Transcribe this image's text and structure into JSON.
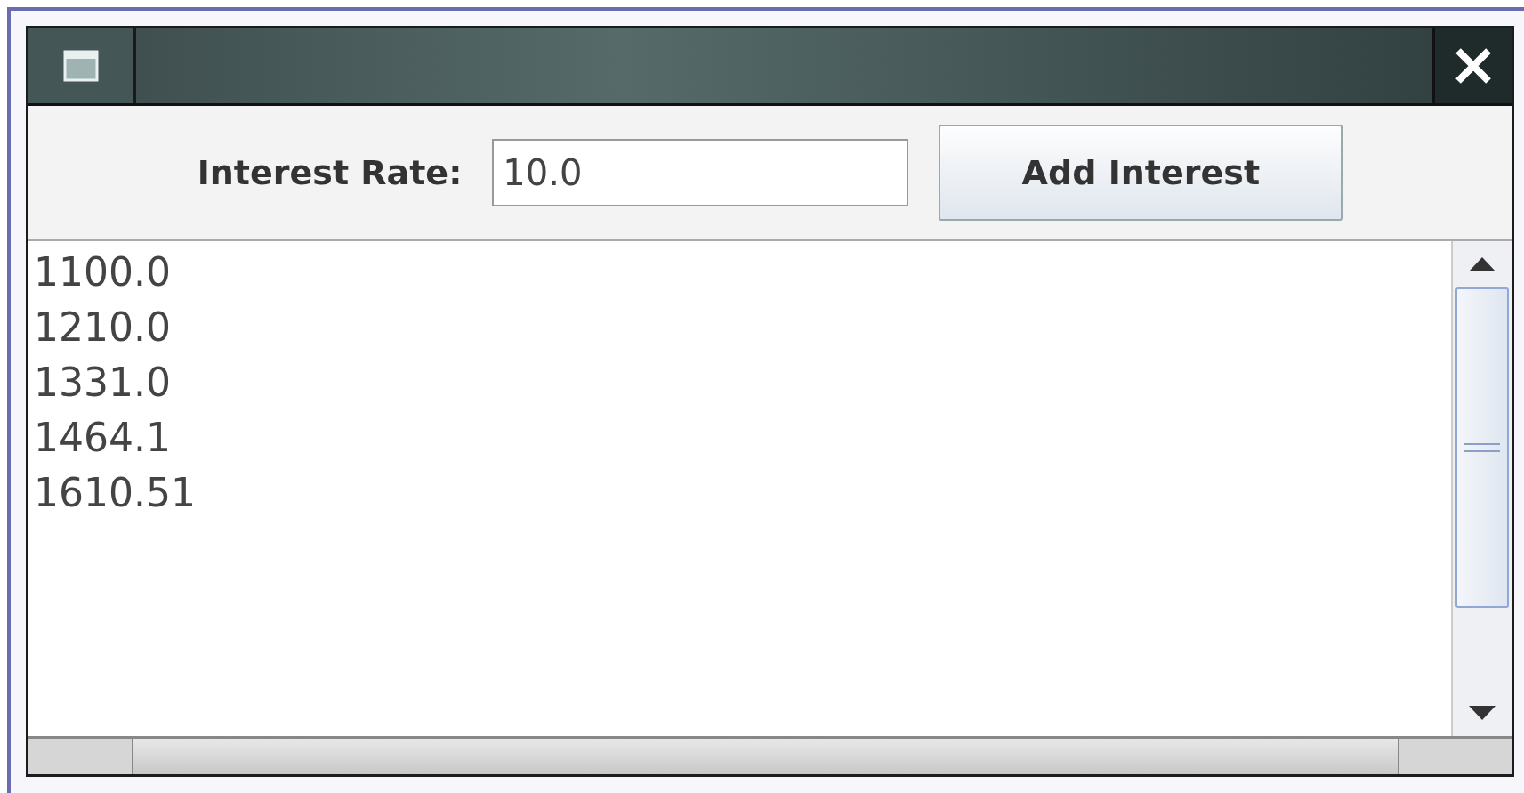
{
  "toolbar": {
    "label": "Interest Rate:",
    "field": {
      "value": "10.0"
    },
    "button": "Add Interest"
  },
  "output_lines": [
    "1100.0",
    "1210.0",
    "1331.0",
    "1464.1",
    "1610.51"
  ]
}
